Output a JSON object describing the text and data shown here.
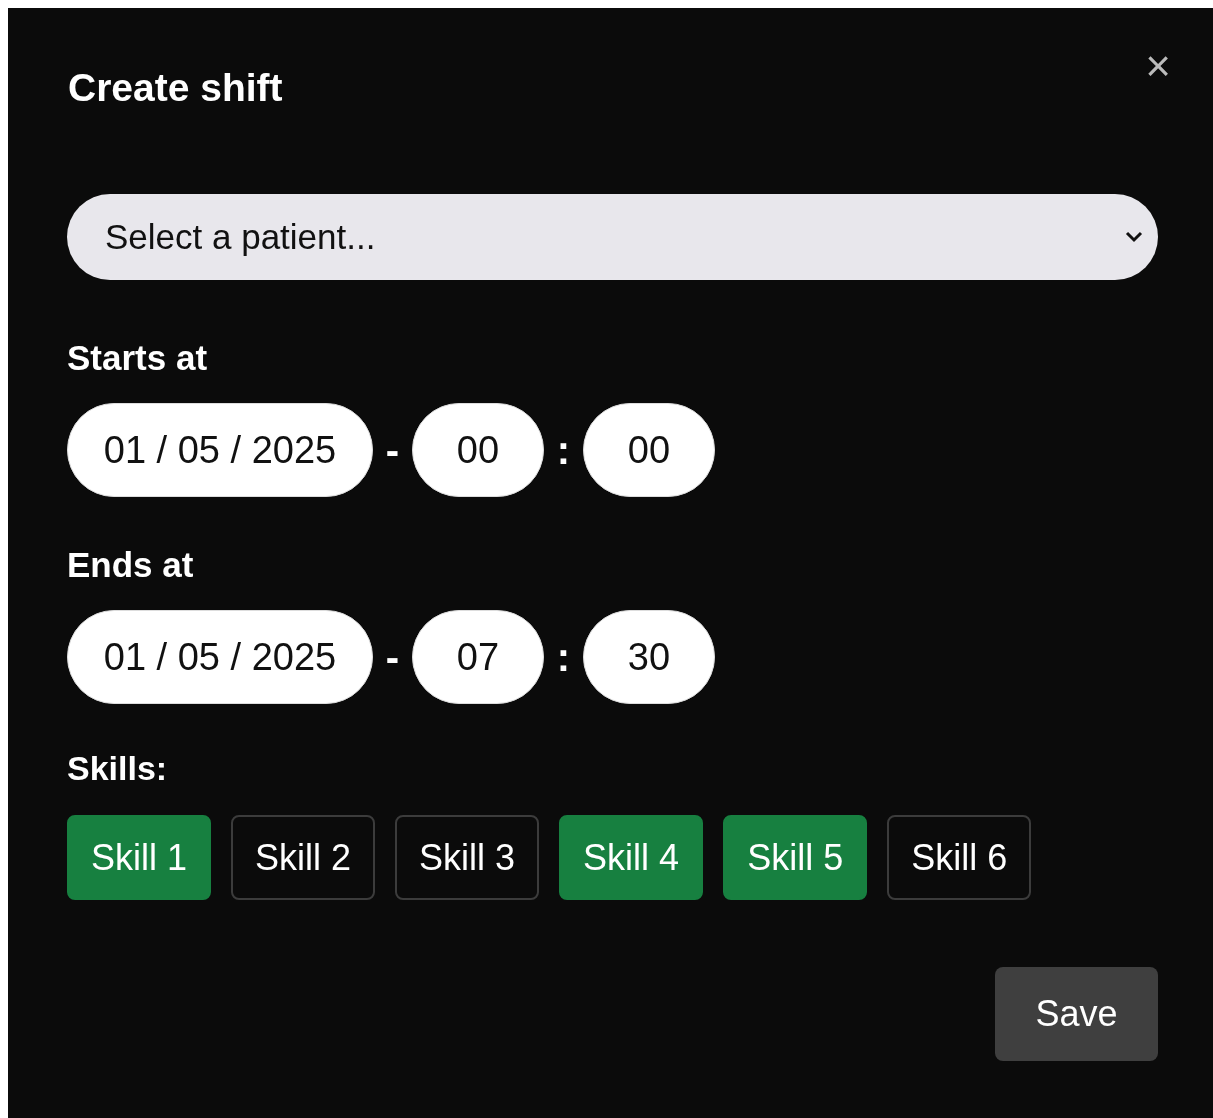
{
  "dialog": {
    "title": "Create shift",
    "close": "×"
  },
  "patient_select": {
    "placeholder": "Select a patient..."
  },
  "starts_at": {
    "label": "Starts at",
    "date": "01 / 05 / 2025",
    "separator": "-",
    "hour": "00",
    "colon": ":",
    "minute": "00"
  },
  "ends_at": {
    "label": "Ends at",
    "date": "01 / 05 / 2025",
    "separator": "-",
    "hour": "07",
    "colon": ":",
    "minute": "30"
  },
  "skills": {
    "label": "Skills:",
    "items": [
      {
        "label": "Skill 1",
        "selected": true
      },
      {
        "label": "Skill 2",
        "selected": false
      },
      {
        "label": "Skill 3",
        "selected": false
      },
      {
        "label": "Skill 4",
        "selected": true
      },
      {
        "label": "Skill 5",
        "selected": true
      },
      {
        "label": "Skill 6",
        "selected": false
      }
    ]
  },
  "save_button": "Save"
}
